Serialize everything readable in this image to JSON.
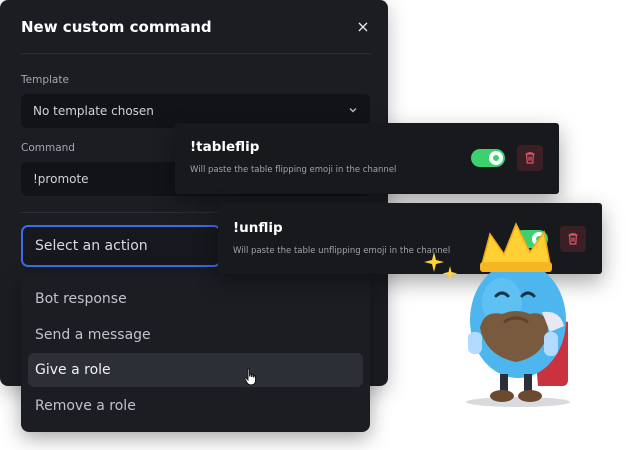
{
  "modal": {
    "title": "New custom command",
    "close_label": "×",
    "template_label": "Template",
    "template_value": "No template chosen",
    "command_label": "Command",
    "command_value": "!promote",
    "action_placeholder": "Select an action"
  },
  "action_options": [
    {
      "label": "Bot response"
    },
    {
      "label": "Send a message"
    },
    {
      "label": "Give a role"
    },
    {
      "label": "Remove a role"
    }
  ],
  "commands": [
    {
      "name": "!tableflip",
      "description": "Will paste the table flipping emoji in the channel",
      "enabled": true
    },
    {
      "name": "!unflip",
      "description": "Will paste the table unflipping emoji in the channel",
      "enabled": true
    }
  ],
  "colors": {
    "toggle_on": "#3bd16f",
    "focus_border": "#3a6be8",
    "trash_icon": "#e0566b"
  }
}
